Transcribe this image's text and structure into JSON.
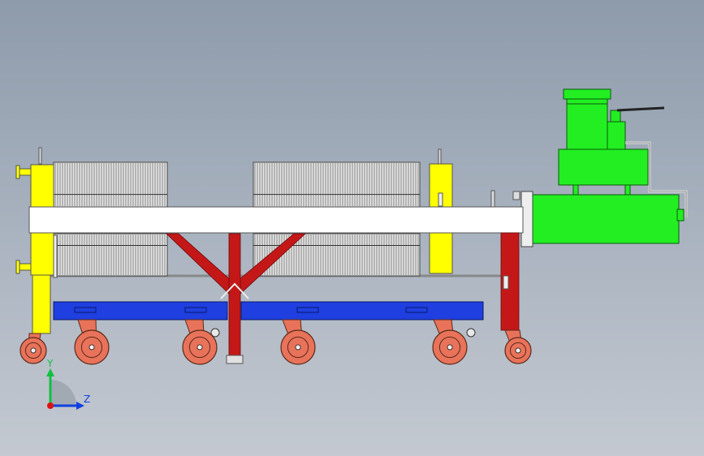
{
  "viewport": {
    "background_top": "#8e9bab",
    "background_bottom": "#c4c9d1"
  },
  "triad": {
    "y_label": "Y",
    "z_label": "Z",
    "y_color": "#10c040",
    "z_color": "#1040e0",
    "x_color": "#e01010"
  },
  "colors": {
    "head": "#ffff00",
    "frame": "#ffffff",
    "plates": "#e6e6e6",
    "plate_line": "#5a5a5a",
    "brace": "#c41818",
    "base": "#1f3fe0",
    "wheel": "#e8735a",
    "wheel_hub": "#ffffff",
    "motor": "#22ee22",
    "motor_dark": "#18b018"
  },
  "model": {
    "plate_groups": [
      "plates-left-upper",
      "plates-left-lower",
      "plates-right-upper",
      "plates-right-lower"
    ],
    "casters": [
      "caster-1",
      "caster-2",
      "caster-3",
      "caster-4",
      "caster-5",
      "caster-6",
      "caster-7"
    ]
  }
}
